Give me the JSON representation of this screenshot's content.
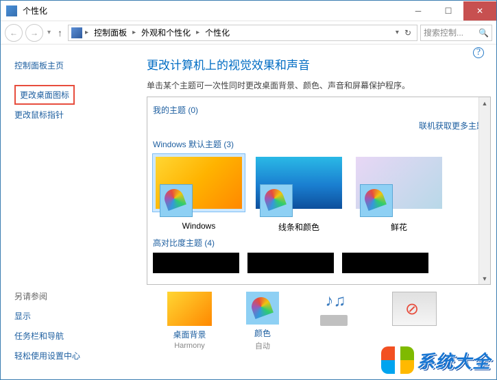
{
  "window": {
    "title": "个性化"
  },
  "breadcrumb": {
    "seg1": "控制面板",
    "seg2": "外观和个性化",
    "seg3": "个性化"
  },
  "search": {
    "placeholder": "搜索控制..."
  },
  "sidebar": {
    "home": "控制面板主页",
    "link1": "更改桌面图标",
    "link2": "更改鼠标指针",
    "see_also": "另请参阅",
    "footer1": "显示",
    "footer2": "任务栏和导航",
    "footer3": "轻松使用设置中心"
  },
  "page": {
    "title": "更改计算机上的视觉效果和声音",
    "subtitle": "单击某个主题可一次性同时更改桌面背景、颜色、声音和屏幕保护程序。"
  },
  "themes": {
    "my_themes": "我的主题 (0)",
    "get_more": "联机获取更多主题",
    "default_themes": "Windows 默认主题 (3)",
    "items": [
      {
        "name": "Windows"
      },
      {
        "name": "线条和颜色"
      },
      {
        "name": "鲜花"
      }
    ],
    "high_contrast": "高对比度主题 (4)"
  },
  "settings": {
    "desktop_bg": {
      "label": "桌面背景",
      "value": "Harmony"
    },
    "color": {
      "label": "颜色",
      "value": "自动"
    }
  },
  "watermark": {
    "text": "系统大全"
  }
}
